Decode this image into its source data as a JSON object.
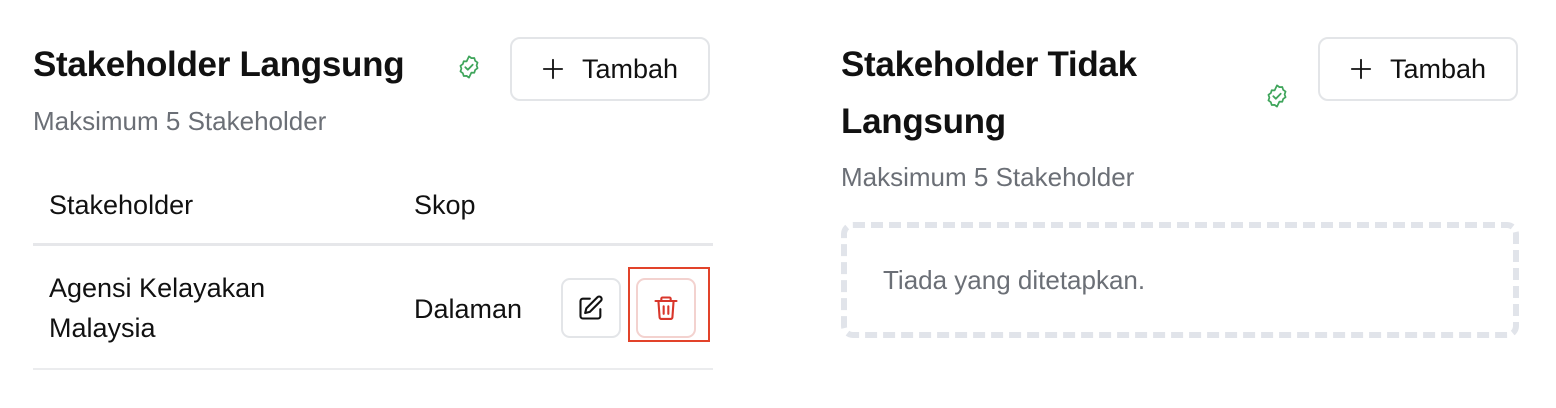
{
  "left_panel": {
    "title": "Stakeholder Langsung",
    "subtitle": "Maksimum 5 Stakeholder",
    "add_label": "Tambah",
    "table": {
      "headers": [
        "Stakeholder",
        "Skop"
      ],
      "rows": [
        {
          "stakeholder": [
            "Agensi Kelayakan",
            "Malaysia"
          ],
          "skop": "Dalaman"
        }
      ]
    }
  },
  "right_panel": {
    "title_lines": [
      "Stakeholder Tidak",
      "Langsung"
    ],
    "subtitle": "Maksimum 5 Stakeholder",
    "add_label": "Tambah",
    "empty_text": "Tiada yang ditetapkan."
  },
  "colors": {
    "check_green": "#3fa55b",
    "delete_red": "#d9362b",
    "highlight_border": "#e2432a",
    "dashed_border": "#e1e4ea"
  },
  "icons": {
    "verified": "check-badge-icon",
    "add": "plus-icon",
    "edit": "pencil-edit-icon",
    "delete": "trash-icon"
  }
}
